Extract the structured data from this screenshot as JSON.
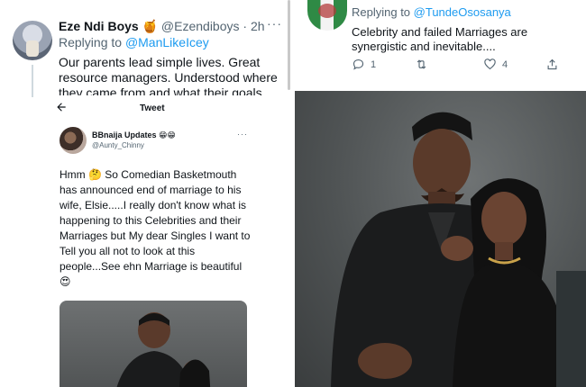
{
  "left_tweet": {
    "author_name": "Eze Ndi Boys 🍯",
    "handle": "@Ezendiboys",
    "time": "· 2h",
    "replying_prefix": "Replying to",
    "replying_to": "@ManLikeIcey",
    "body": "Our parents lead simple lives. Great resource managers. Understood where they came from and what their goals",
    "more_icon": "more-horizontal-icon"
  },
  "embedded": {
    "header_title": "Tweet",
    "back_icon": "arrow-left-icon",
    "author_name": "BBnaija Updates 😁😁",
    "handle": "@Aunty_Chinny",
    "body": "Hmm 🤔 So Comedian Basketmouth has announced end of marriage to his wife, Elsie.....I really don't know what is happening to this Celebrities and their Marriages but My dear Singles I want to Tell you all not to look at this people...See ehn Marriage is beautiful 😍"
  },
  "right_tweet": {
    "replying_prefix": "Replying to",
    "replying_to": "@TundeOsosanya",
    "body": "Celebrity and  failed Marriages are synergistic and inevitable....",
    "actions": {
      "reply_count": "1",
      "retweet_count": "",
      "like_count": "4"
    },
    "colors": {
      "link": "#1d9bf0",
      "muted": "#536471"
    }
  }
}
